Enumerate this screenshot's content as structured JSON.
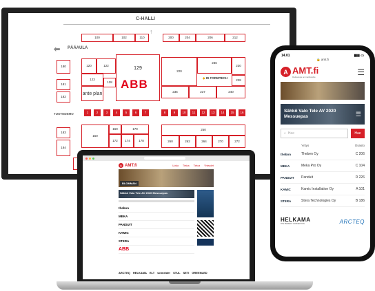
{
  "floorplan": {
    "hall_label": "C-HALLI",
    "main_hall_label": "PÄÄAULA",
    "tuotedemo_label": "TUOTEDEMO",
    "booths_top": [
      "100",
      "102",
      "110",
      "200",
      "204",
      "206",
      "212"
    ],
    "booths_left": [
      "180",
      "181",
      "182",
      "183",
      "184"
    ],
    "booths_mid": [
      "120",
      "122",
      "123",
      "128",
      "129",
      "220",
      "236",
      "230",
      "228",
      "235",
      "237",
      "240"
    ],
    "booths_demo": [
      "1",
      "2",
      "3",
      "4",
      "5",
      "6",
      "7",
      "8",
      "9",
      "10",
      "11",
      "12",
      "13",
      "14",
      "15",
      "16"
    ],
    "booths_low": [
      "150",
      "160",
      "170",
      "172",
      "174",
      "178",
      "250",
      "260",
      "262",
      "264",
      "270",
      "272"
    ],
    "anteplan_label": "ante plan",
    "abb_label": "ABB",
    "idformtech_label": "ID FORMTECH"
  },
  "laptop": {
    "logo": "AMT.fi",
    "nav": [
      "Uusia",
      "Tietoa",
      "Tietoa",
      "Yhteydet"
    ],
    "hero_title": "Sähkö Valo Tele AV 2020 Messuepas",
    "banner_title": "BLOMMAN",
    "exhibitors": [
      "thebon",
      "MEKA",
      "PANDUIT",
      "KAMIC",
      "STERA",
      "ABB"
    ],
    "footer_logos": [
      "ARCTEQ",
      "HELKAMA",
      "ELT",
      "schneider",
      "STUL",
      "SETI",
      "GREENLED"
    ]
  },
  "phone": {
    "time": "14.01",
    "url": "amt.fi",
    "logo": "AMT.fi",
    "logo_sub": "Ratkaisuja ammattilaisille",
    "hero_title": "Sähkö Valo Tele AV 2020 Messuepas",
    "search_placeholder": "Hae",
    "search_button": "Hae",
    "col_company": "Yritys",
    "col_booth": "Osasto",
    "rows": [
      {
        "logo": "thebon",
        "name": "Theben Oy",
        "booth": "C 206"
      },
      {
        "logo": "MEKA",
        "name": "Meka Pro Oy",
        "booth": "C 104"
      },
      {
        "logo": "PANDUIT",
        "name": "Panduit",
        "booth": "D 226"
      },
      {
        "logo": "KAMIC",
        "name": "Kamic Installation Oy",
        "booth": "A 101"
      },
      {
        "logo": "STERA",
        "name": "Stera Technologies Oy",
        "booth": "B 186"
      }
    ],
    "footer_left": "HELKAMA",
    "footer_left_sub": "THE PERFECT CONNECTION",
    "footer_right": "ARCTEQ"
  },
  "colors": {
    "accent": "#d62028",
    "dark": "#1b1b1b"
  }
}
